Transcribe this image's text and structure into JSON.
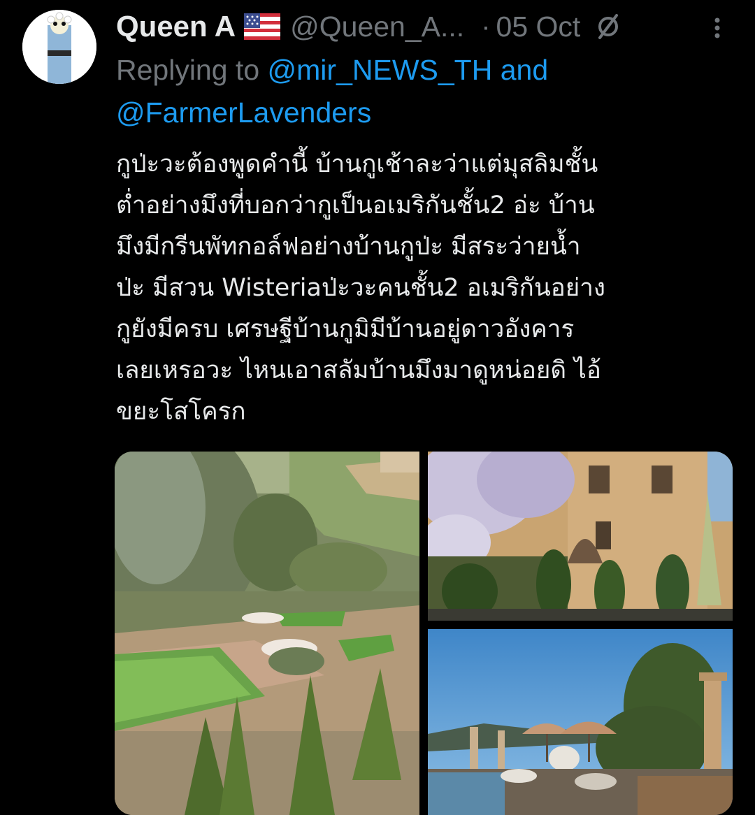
{
  "tweet": {
    "author": {
      "display_name": "Queen A",
      "flag_icon": "us-flag-icon",
      "handle": "@Queen_A...",
      "avatar_icon": "avatar"
    },
    "separator": "·",
    "date": "05 Oct",
    "reply": {
      "prefix": "Replying to",
      "mention_1": "@mir_NEWS_TH",
      "conjunction": "and",
      "mention_2": "@FarmerLavenders"
    },
    "text": "กูป่ะวะต้องพูดคำนี้ บ้านกูเช้าละว่าแต่มุสลิมชั้น\nต่ำอย่างมึงที่บอกว่ากูเป็นอเมริกันชั้น2 อ่ะ บ้าน\nมึงมีกรีนพัทกอล์ฟอย่างบ้านกูป่ะ มีสระว่ายน้ำ\nป่ะ มีสวน Wisteriaป่ะวะคนชั้น2 อเมริกันอย่าง\nกูยังมีครบ เศรษฐีบ้านกูมิมีบ้านอยู่ดาวอังคาร\nเลยเหรอวะ ไหนเอาสลัมบ้านมึงมาดูหน่อยดิ ไอ้\nขยะโสโครก",
    "media": [
      {
        "name": "media-garden-putting-green"
      },
      {
        "name": "media-villa-wisteria"
      },
      {
        "name": "media-pool-umbrellas"
      }
    ]
  },
  "colors": {
    "background": "#000000",
    "primary_text": "#e7e9ea",
    "secondary_text": "#71767b",
    "link": "#1d9bf0"
  }
}
